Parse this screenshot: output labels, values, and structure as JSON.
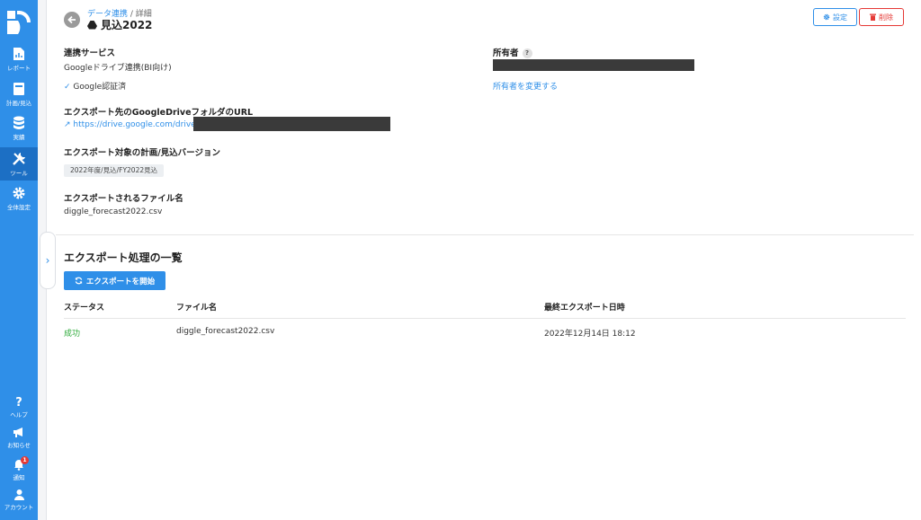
{
  "sidebar": {
    "items": [
      {
        "label": "レポート",
        "icon": "report-icon"
      },
      {
        "label": "計画/見込",
        "icon": "book-icon"
      },
      {
        "label": "実績",
        "icon": "database-icon"
      },
      {
        "label": "ツール",
        "icon": "tools-icon"
      },
      {
        "label": "全体設定",
        "icon": "gear-icon"
      }
    ],
    "bottom_items": [
      {
        "label": "ヘルプ",
        "icon": "help-icon"
      },
      {
        "label": "お知らせ",
        "icon": "megaphone-icon"
      },
      {
        "label": "通知",
        "icon": "bell-icon",
        "badge": "1"
      },
      {
        "label": "アカウント",
        "icon": "user-icon"
      }
    ],
    "active_index": 3
  },
  "header": {
    "breadcrumb_link": "データ連携",
    "breadcrumb_separator": " / ",
    "breadcrumb_current": "詳細",
    "title": "見込2022",
    "settings_label": "設定",
    "delete_label": "削除"
  },
  "details": {
    "service_label": "連携サービス",
    "service_value": "Googleドライブ連携(BI向け)",
    "auth_status": "Google認証済",
    "owner_label": "所有者",
    "owner_help": "?",
    "owner_change_link": "所有者を変更する",
    "folder_label": "エクスポート先のGoogleDriveフォルダのURL",
    "folder_url": "https://drive.google.com/drive",
    "version_label": "エクスポート対象の計画/見込バージョン",
    "version_tag": "2022年度/見込/FY2022見込",
    "filename_label": "エクスポートされるファイル名",
    "filename_value": "diggle_forecast2022.csv"
  },
  "exports": {
    "title": "エクスポート処理の一覧",
    "start_button": "エクスポートを開始",
    "columns": [
      "ステータス",
      "ファイル名",
      "最終エクスポート日時"
    ],
    "rows": [
      {
        "status": "成功",
        "filename": "diggle_forecast2022.csv",
        "datetime": "2022年12月14日 18:12"
      }
    ]
  },
  "colors": {
    "accent": "#2f8fe8",
    "danger": "#e53935",
    "success": "#2eaa3a"
  }
}
